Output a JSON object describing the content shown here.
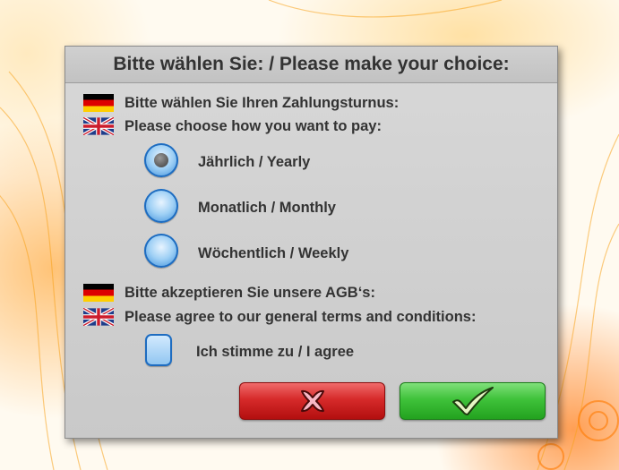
{
  "dialog": {
    "title": "Bitte wählen Sie: / Please make your choice:",
    "payment": {
      "heading_de": "Bitte wählen Sie Ihren Zahlungsturnus:",
      "heading_en": "Please choose how you want to pay:",
      "selected": "yearly",
      "options": [
        {
          "id": "yearly",
          "label": "Jährlich / Yearly",
          "selected": true
        },
        {
          "id": "monthly",
          "label": "Monatlich / Monthly",
          "selected": false
        },
        {
          "id": "weekly",
          "label": "Wöchentlich / Weekly",
          "selected": false
        }
      ]
    },
    "terms": {
      "heading_de": "Bitte akzeptieren Sie unsere AGB‘s:",
      "heading_en": "Please agree to our general terms and conditions:",
      "checkbox_label": "Ich stimme zu / I agree",
      "checked": false
    },
    "buttons": {
      "cancel_icon": "cross-icon",
      "confirm_icon": "checkmark-icon"
    }
  },
  "icons": {
    "flag_de": "german-flag-icon",
    "flag_uk": "uk-flag-icon"
  },
  "colors": {
    "cancel": "#d62a2a",
    "confirm": "#3fc23a",
    "radio": "#2f86d8",
    "dialog_bg": "#d0d0d0"
  }
}
